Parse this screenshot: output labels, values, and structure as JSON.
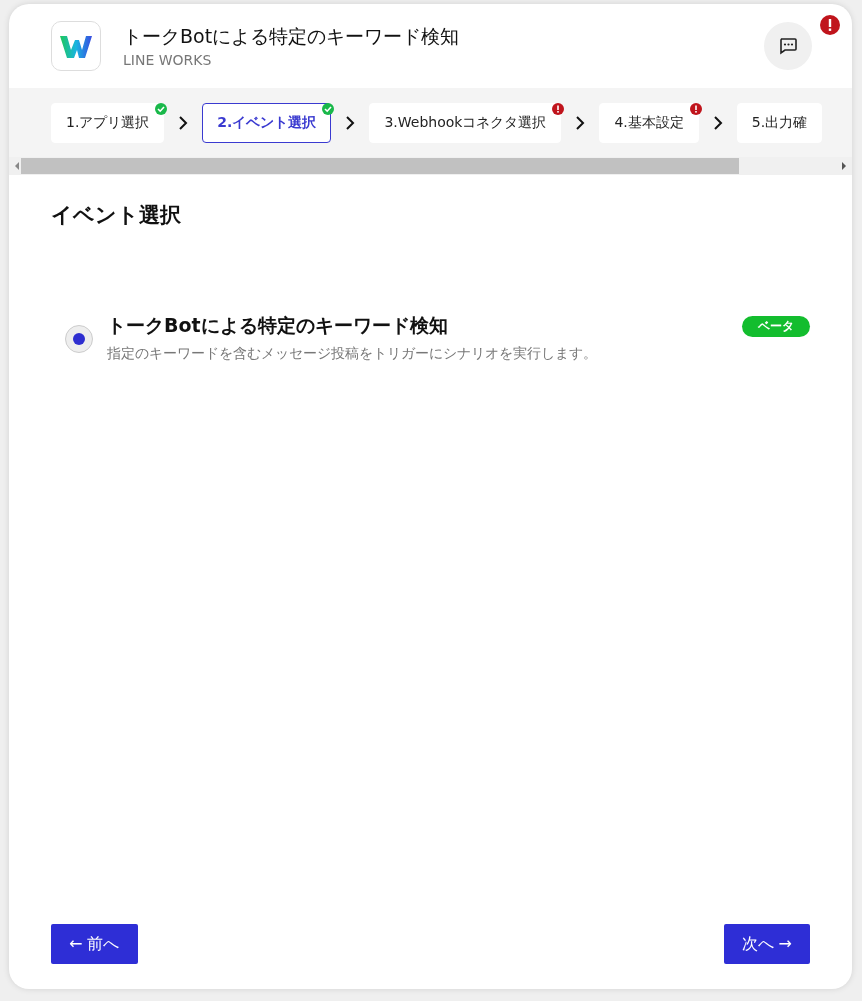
{
  "header": {
    "title": "トークBotによる特定のキーワード検知",
    "subtitle": "LINE WORKS"
  },
  "steps": [
    {
      "label": "1.アプリ選択",
      "kind": "done",
      "selected": false
    },
    {
      "label": "2.イベント選択",
      "kind": "done",
      "selected": true
    },
    {
      "label": "3.Webhookコネクタ選択",
      "kind": "error",
      "selected": false
    },
    {
      "label": "4.基本設定",
      "kind": "error",
      "selected": false
    },
    {
      "label": "5.出力確",
      "kind": "plain",
      "selected": false
    }
  ],
  "section_title": "イベント選択",
  "options": [
    {
      "title": "トークBotによる特定のキーワード検知",
      "description": "指定のキーワードを含むメッセージ投稿をトリガーにシナリオを実行します。",
      "badge": "ベータ",
      "selected": true
    }
  ],
  "buttons": {
    "back": "← 前へ",
    "next": "次へ →"
  }
}
